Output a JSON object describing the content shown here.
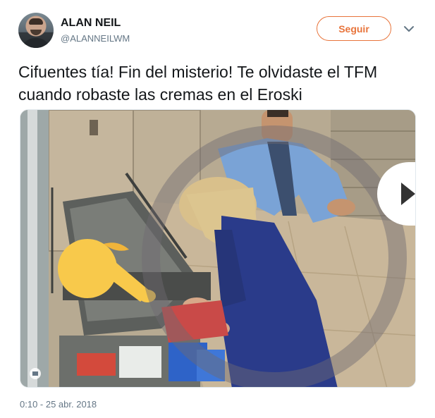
{
  "author": {
    "name": "ALAN NEIL",
    "handle": "@ALANNEILWM"
  },
  "follow_button": {
    "label": "Seguir"
  },
  "tweet": {
    "text": "Cifuentes tía! Fin del misterio! Te olvidaste el TFM cuando robaste las cremas en el Eroski"
  },
  "meta": {
    "timestamp": "0:10 - 25 abr. 2018"
  },
  "icons": {
    "caret": "chevron-down-icon",
    "play": "play-icon",
    "pointing_hand": "pointing-hand-emoji"
  },
  "colors": {
    "accent": "#e8743b",
    "secondary_text": "#657786"
  }
}
